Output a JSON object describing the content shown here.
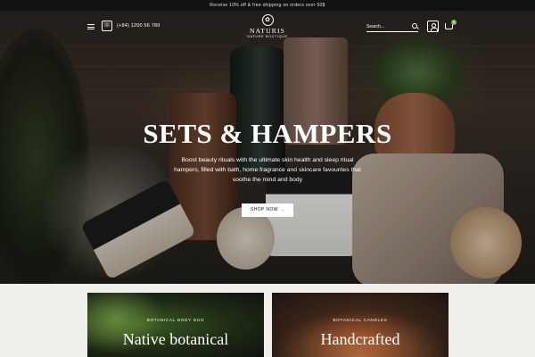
{
  "announcement": "Receive 10% off & free shipping on orders over 50$",
  "header": {
    "phone": "(+84) 1200 56 789",
    "logo_name": "NATURIS",
    "logo_tagline": "NATURE BOUTIQUE",
    "search_placeholder": "Search...",
    "cart_count": "0"
  },
  "hero": {
    "title": "SETS & HAMPERS",
    "subtitle": "Boost beauty rituals with the ultimate skin health and sleep ritual hampers, filled with bath, home fragrance and skincare favourites that soothe the mind and body",
    "cta": "SHOP NOW →"
  },
  "cards": [
    {
      "eyebrow": "BOTANICAL BODY DUO",
      "title": "Native botanical"
    },
    {
      "eyebrow": "BOTANICAL CANDLES",
      "title": "Handcrafted"
    }
  ],
  "colors": {
    "accent": "#7fb36a",
    "dark": "#111111",
    "background": "#f1efea"
  }
}
